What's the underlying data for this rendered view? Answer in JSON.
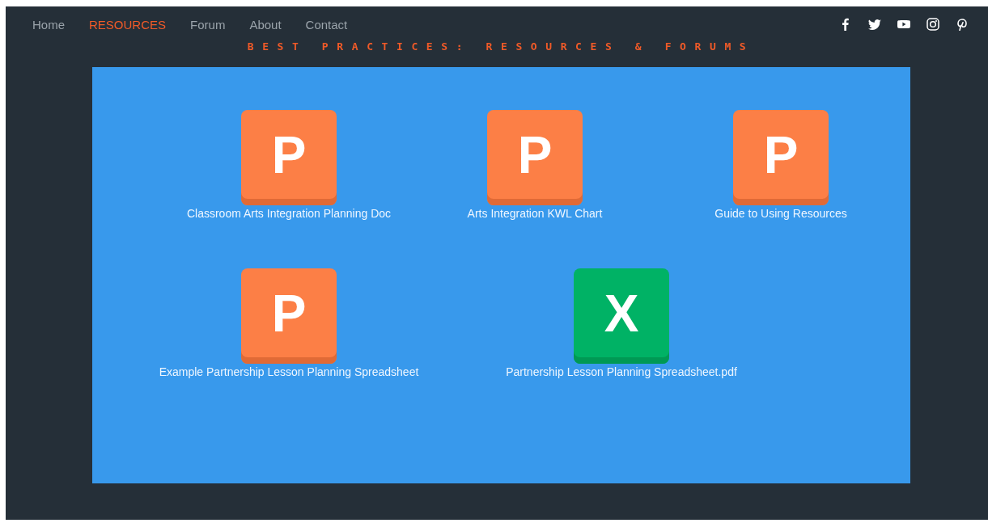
{
  "nav": [
    {
      "label": "Home",
      "selected": false
    },
    {
      "label": "RESOURCES",
      "selected": true
    },
    {
      "label": "Forum",
      "selected": false
    },
    {
      "label": "About",
      "selected": false
    },
    {
      "label": "Contact",
      "selected": false
    }
  ],
  "page_title": "BEST PRACTICES: RESOURCES & FORUMS",
  "file_rows": [
    [
      {
        "kind": "powerpoint",
        "letter": "P",
        "name": "Classroom Arts Integration Planning Doc"
      },
      {
        "kind": "powerpoint",
        "letter": "P",
        "name": "Arts Integration KWL Chart"
      },
      {
        "kind": "powerpoint",
        "letter": "P",
        "name": "Guide to Using Resources"
      }
    ],
    [
      {
        "kind": "powerpoint",
        "letter": "P",
        "name": "Example Partnership Lesson Planning Spreadsheet"
      },
      {
        "kind": "excel",
        "letter": "X",
        "name": "Partnership Lesson Planning Spreadsheet.pdf"
      }
    ]
  ]
}
